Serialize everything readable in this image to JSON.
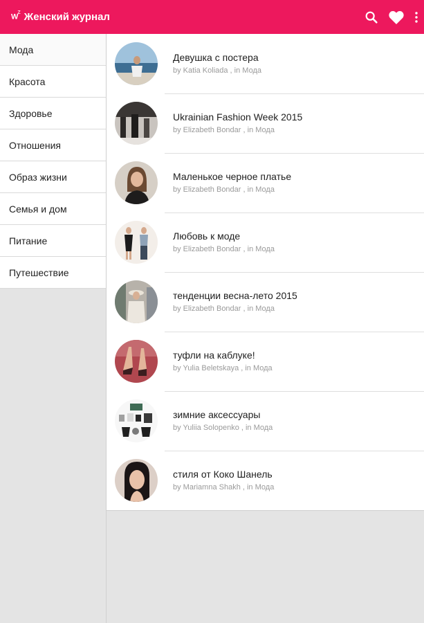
{
  "app": {
    "logo_text": "W",
    "logo_sup": "Z",
    "title": "Женский журнал"
  },
  "colors": {
    "appbar": "#ed185d",
    "text": "#1e1e1e",
    "meta": "#9a9a9a"
  },
  "toolbar": {
    "icons": [
      "search-icon",
      "heart-icon",
      "more-vert-icon"
    ]
  },
  "sidebar": {
    "items": [
      {
        "label": "Мода"
      },
      {
        "label": "Красота"
      },
      {
        "label": "Здоровье"
      },
      {
        "label": "Отношения"
      },
      {
        "label": "Образ жизни"
      },
      {
        "label": "Семья и дом"
      },
      {
        "label": "Питание"
      },
      {
        "label": "Путешествие"
      }
    ]
  },
  "articles": [
    {
      "title": "Девушка с постера",
      "meta": "by Katia Koliada , in Мода"
    },
    {
      "title": "Ukrainian Fashion Week 2015",
      "meta": "by Elizabeth Bondar , in Мода"
    },
    {
      "title": "Маленькое черное платье",
      "meta": "by Elizabeth Bondar , in Мода"
    },
    {
      "title": "Любовь к моде",
      "meta": "by Elizabeth Bondar , in Мода"
    },
    {
      "title": "тенденции весна-лето 2015",
      "meta": "by Elizabeth Bondar , in Мода"
    },
    {
      "title": "туфли на каблуке!",
      "meta": "by Yulia Beletskaya , in Мода"
    },
    {
      "title": "зимние аксессуары",
      "meta": "by Yuliia Solopenko , in Мода"
    },
    {
      "title": "стиля от Коко Шанель",
      "meta": "by Mariamna Shakh , in Мода"
    }
  ]
}
